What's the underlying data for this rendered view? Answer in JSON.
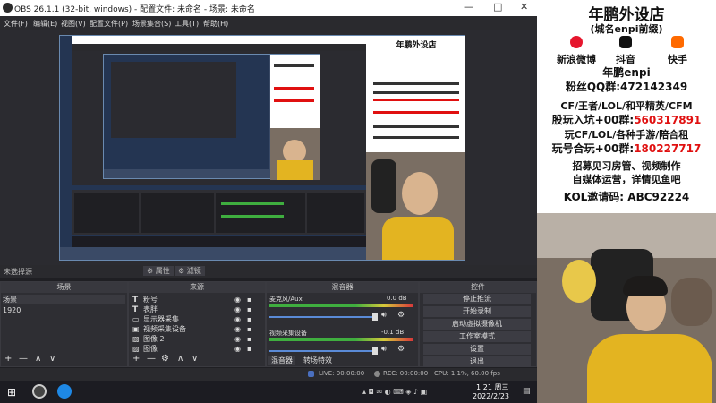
{
  "window": {
    "title": "OBS 26.1.1 (32-bit, windows) - 配置文件: 未命名 - 场景: 未命名",
    "minimize": "—",
    "maximize": "□",
    "close": "✕"
  },
  "menu": [
    "文件(F)",
    "编辑(E)",
    "视图(V)",
    "配置文件(P)",
    "场景集合(S)",
    "工具(T)",
    "帮助(H)"
  ],
  "source_status": {
    "no_source": "未选择源",
    "properties": "属性",
    "filters": "滤镜"
  },
  "scenes": {
    "title": "场景",
    "items": [
      "场景",
      "1920"
    ],
    "toolbar": [
      "+",
      "—",
      "∧",
      "∨"
    ]
  },
  "sources": {
    "title": "来源",
    "items": [
      "粉号",
      "表胖",
      "显示器采集",
      "视频采集设备",
      "图像 2",
      "图像"
    ],
    "toolbar": [
      "+",
      "—",
      "⚙",
      "∧",
      "∨"
    ]
  },
  "mixer": {
    "title": "混音器",
    "track1": {
      "name": "麦克风/Aux",
      "db": "0.0 dB"
    },
    "track2": {
      "name": "视频采集设备",
      "db": "-0.1 dB"
    },
    "tabs": [
      "混音器",
      "转场特效"
    ]
  },
  "controls": {
    "title": "控件",
    "buttons": [
      "停止推流",
      "开始录制",
      "启动虚拟摄像机",
      "工作室模式",
      "设置",
      "退出"
    ]
  },
  "statusbar": {
    "live": "LIVE: 00:00:00",
    "rec": "REC: 00:00:00",
    "cpu": "CPU: 1.1%, 60.00 fps"
  },
  "taskbar": {
    "time": "1:21 周三",
    "date": "2022/2/23"
  },
  "overlay": {
    "shop_title": "年鹏外设店",
    "shop_sub": "(城名enpi前缀)",
    "socials": [
      {
        "label": "新浪微博",
        "icon": "weibo-icon"
      },
      {
        "label": "抖音",
        "icon": "douyin-icon"
      },
      {
        "label": "快手",
        "icon": "kuaishou-icon"
      }
    ],
    "name_line": "年鹏enpi",
    "fan_group_label": "粉丝QQ群:",
    "fan_group_num": "472142349",
    "games_line": "CF/王者/LOL/和平精英/CFM",
    "group1_label": "股玩入坑+00群:",
    "group1_num": "560317891",
    "games_line2": "玩CF/LOL/各种手游/陪合租",
    "group2_label": "玩号合玩+00群:",
    "group2_num": "180227717",
    "recruit1": "招募见习房管、视频制作",
    "recruit2": "自媒体运营，详情见鱼吧",
    "kol": "KOL邀请码: ABC92224"
  },
  "colors": {
    "accent_red": "#e01010",
    "obs_dark": "#2a2a2e",
    "stop_stream": "#3c3c43"
  }
}
